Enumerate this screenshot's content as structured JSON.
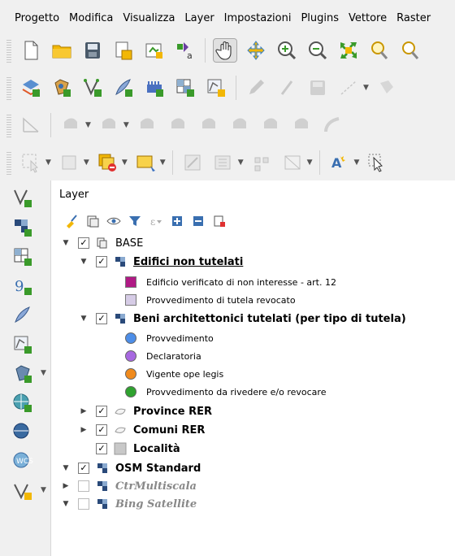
{
  "menubar": {
    "items": [
      "Progetto",
      "Modifica",
      "Visualizza",
      "Layer",
      "Impostazioni",
      "Plugins",
      "Vettore",
      "Raster"
    ]
  },
  "toolbars": {
    "file": [
      "new-project-icon",
      "open-project-icon",
      "save-project-icon",
      "save-as-icon",
      "print-layout-icon",
      "style-manager-icon",
      "pan-icon",
      "pan-to-selection-icon",
      "zoom-in-icon",
      "zoom-out-icon",
      "zoom-full-icon",
      "zoom-to-selection-icon",
      "zoom-layer-icon"
    ],
    "layers": [
      "add-layer-icon",
      "add-postgis-icon",
      "add-vector-icon",
      "add-line-icon",
      "add-wms-icon",
      "add-raster-icon",
      "new-shapefile-icon",
      "edit-pencil-icon",
      "digitize-icon",
      "save-edits-icon",
      "add-line-feature-icon",
      "add-polygon-feature-icon",
      "vertex-tool-icon"
    ],
    "advanced": [
      "snapping-icon",
      "rotate-icon",
      "move-icon",
      "simplify-icon",
      "add-ring-icon",
      "fill-ring-icon",
      "delete-ring-icon",
      "split-icon",
      "merge-icon",
      "reshape-icon",
      "offset-icon"
    ],
    "selection": [
      "select-icon",
      "attribute-table-icon",
      "deselect-icon",
      "label-icon",
      "identify-icon",
      "measure-icon",
      "field-calc-icon",
      "vertex-edit-icon",
      "label-toolbar-icon",
      "pointer-icon"
    ]
  },
  "layers_panel": {
    "title": "Layer",
    "tools": [
      "style-brush-icon",
      "add-group-icon",
      "visibility-eye-icon",
      "filter-funnel-icon",
      "filter-expression-icon",
      "expand-all-icon",
      "collapse-all-icon",
      "remove-layer-icon"
    ],
    "tree": [
      {
        "label": "BASE",
        "checked": true,
        "expanded": true,
        "kind": "group"
      },
      {
        "label": "Edifici non tutelati",
        "checked": true,
        "expanded": true,
        "kind": "vector"
      },
      {
        "label": "Edificio verificato di non interesse - art. 12",
        "color": "#b01a85"
      },
      {
        "label": "Provvedimento di tutela revocato",
        "color": "#d6cce6"
      },
      {
        "label": "Beni architettonici tutelati (per tipo di tutela)",
        "checked": true,
        "expanded": true,
        "kind": "vector"
      },
      {
        "label": "Provvedimento",
        "color": "#4d8ee8"
      },
      {
        "label": "Declaratoria",
        "color": "#a768e0"
      },
      {
        "label": "Vigente ope legis",
        "color": "#f08a1c"
      },
      {
        "label": "Provvedimento da rivedere e/o revocare",
        "color": "#2fa22f"
      },
      {
        "label": "Province RER",
        "checked": true,
        "expanded": false,
        "kind": "polygon"
      },
      {
        "label": "Comuni RER",
        "checked": true,
        "expanded": false,
        "kind": "polygon"
      },
      {
        "label": "Località",
        "checked": true,
        "kind": "raster"
      },
      {
        "label": "OSM Standard",
        "checked": true,
        "expanded": false,
        "kind": "tile"
      },
      {
        "label": "CtrMultiscala",
        "checked": false,
        "expanded": false,
        "kind": "tile"
      },
      {
        "label": "Bing Satellite",
        "checked": false,
        "expanded": true,
        "kind": "tile"
      }
    ]
  },
  "colors": {
    "accent_green": "#3a9a2a",
    "folder_yellow": "#f2b705",
    "panel_bg": "#ffffff",
    "chrome_bg": "#f0f0f0"
  }
}
